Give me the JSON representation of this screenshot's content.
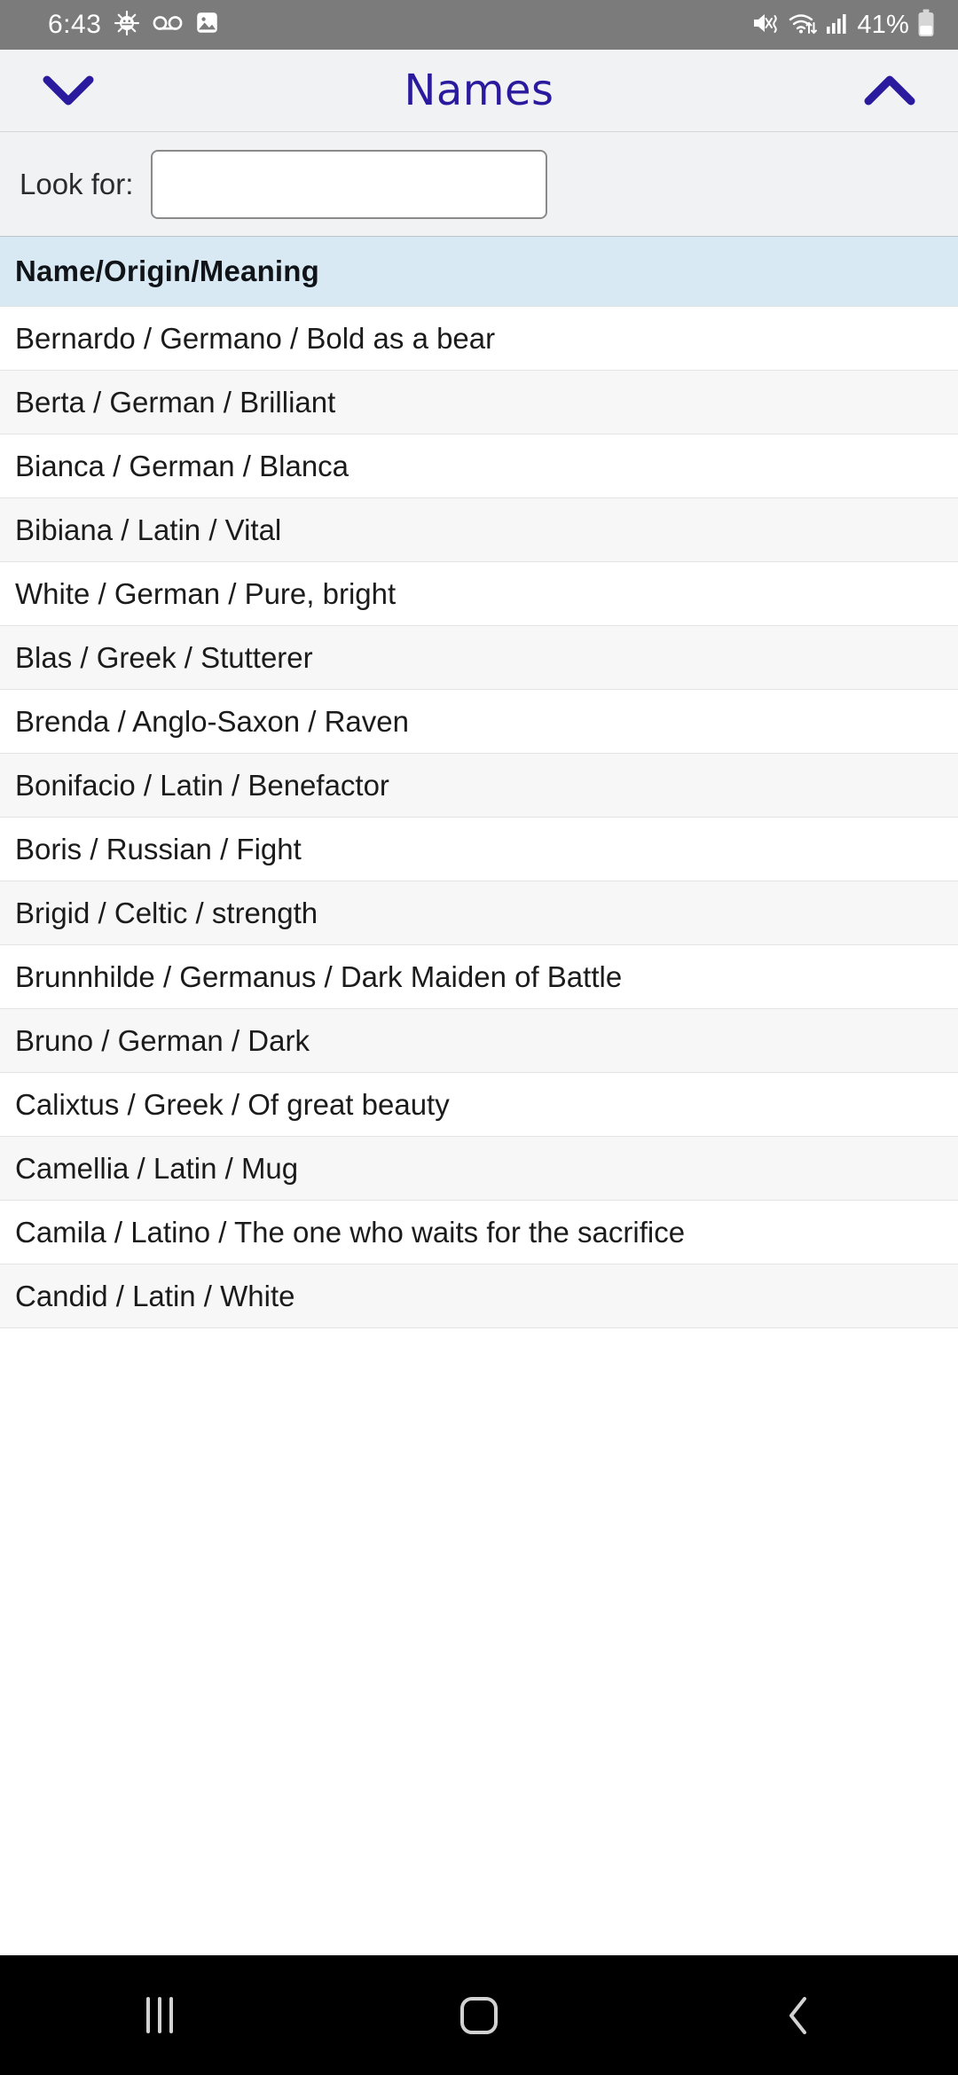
{
  "status_bar": {
    "time": "6:43",
    "battery_percent": "41%",
    "left_icons": [
      "android-bug-icon",
      "voicemail-icon",
      "gallery-image-icon"
    ],
    "right_icons": [
      "mute-vibrate-icon",
      "wifi-icon",
      "cellular-signal-icon",
      "battery-icon"
    ]
  },
  "header": {
    "title": "Names",
    "left_icon": "chevron-down-icon",
    "right_icon": "chevron-up-icon",
    "accent_color": "#2a1a9e"
  },
  "search": {
    "label": "Look for:",
    "value": "",
    "placeholder": ""
  },
  "table": {
    "header": "Name/Origin/Meaning",
    "header_bg": "#d9e9f3",
    "rows": [
      "Bernardo / Germano / Bold as a bear",
      "Berta / German / Brilliant",
      "Bianca / German / Blanca",
      "Bibiana / Latin / Vital",
      "White / German / Pure, bright",
      "Blas / Greek / Stutterer",
      "Brenda / Anglo-Saxon / Raven",
      "Bonifacio / Latin / Benefactor",
      "Boris / Russian / Fight",
      "Brigid / Celtic / strength",
      "Brunnhilde / Germanus / Dark Maiden of Battle",
      "Bruno / German / Dark",
      "Calixtus / Greek / Of great beauty",
      "Camellia / Latin / Mug",
      "Camila / Latino / The one who waits for the sacrifice",
      "Candid / Latin / White"
    ]
  },
  "nav_bar": {
    "recents_label": "recents-icon",
    "home_label": "home-icon",
    "back_label": "back-icon"
  }
}
